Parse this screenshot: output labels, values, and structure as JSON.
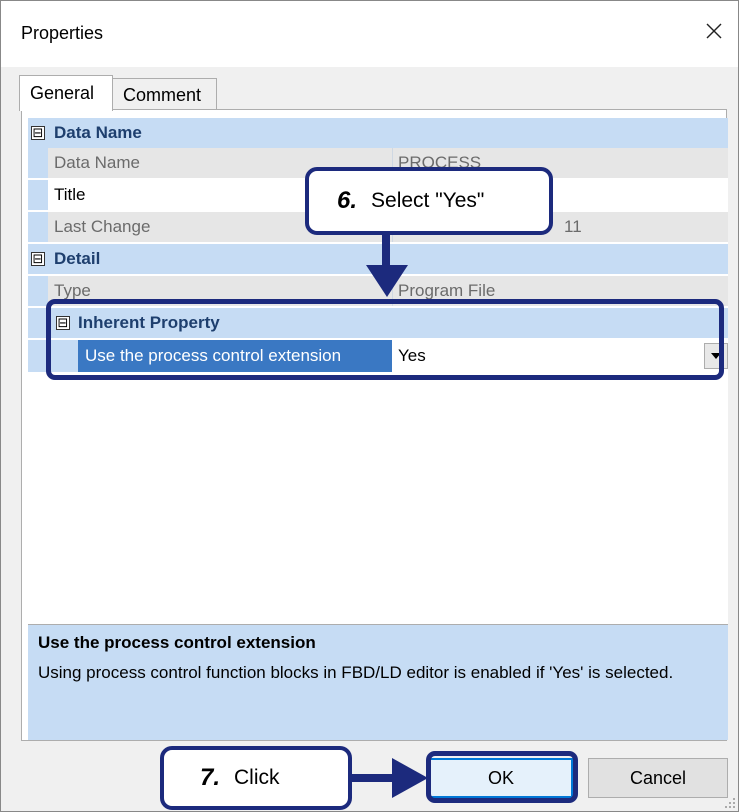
{
  "window": {
    "title": "Properties"
  },
  "tabs": [
    {
      "label": "General",
      "active": true
    },
    {
      "label": "Comment",
      "active": false
    }
  ],
  "grid": {
    "sections": {
      "data_name": {
        "label": "Data Name"
      },
      "detail": {
        "label": "Detail"
      },
      "inherent": {
        "label": "Inherent Property"
      }
    },
    "rows": {
      "data_name": {
        "name": "Data Name",
        "value": "PROCESS"
      },
      "title": {
        "name": "Title",
        "value": ""
      },
      "last_change": {
        "name": "Last Change",
        "value": "11"
      },
      "type": {
        "name": "Type",
        "value": "Program File"
      },
      "pc_ext": {
        "name": "Use the process control extension",
        "value": "Yes"
      }
    },
    "collapse_glyph": "⊟"
  },
  "description": {
    "title": "Use the process control extension",
    "body": "Using process control function blocks in FBD/LD editor is enabled if 'Yes' is selected."
  },
  "buttons": {
    "ok": "OK",
    "cancel": "Cancel"
  },
  "annotations": {
    "step6": {
      "num": "6.",
      "text": "Select \"Yes\""
    },
    "step7": {
      "num": "7.",
      "text": "Click"
    }
  },
  "colors": {
    "annotation": "#1c2a7d",
    "category_bg": "#c6dcf4",
    "selection": "#3a78c3"
  }
}
